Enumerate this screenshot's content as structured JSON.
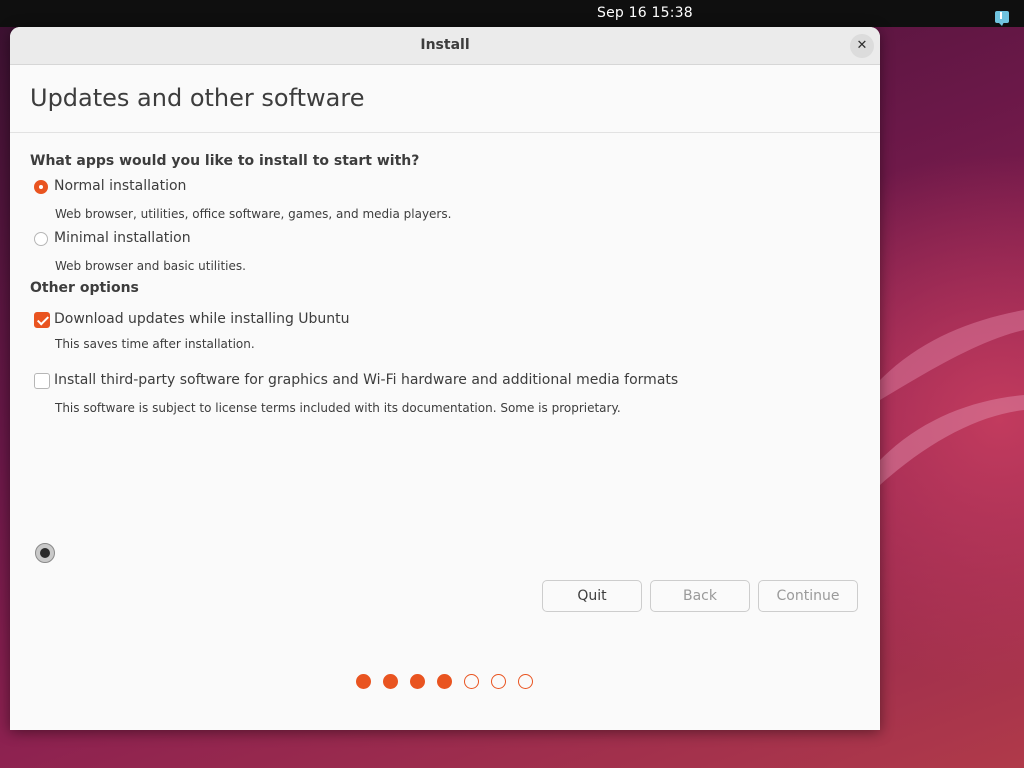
{
  "topbar": {
    "clock": "Sep 16  15:38",
    "notification_icon": "notification-icon"
  },
  "window": {
    "title": "Install",
    "close_icon": "close-icon"
  },
  "page": {
    "title": "Updates and other software"
  },
  "apps_section": {
    "heading": "What apps would you like to install to start with?",
    "options": [
      {
        "label": "Normal installation",
        "description": "Web browser, utilities, office software, games, and media players.",
        "selected": true
      },
      {
        "label": "Minimal installation",
        "description": "Web browser and basic utilities.",
        "selected": false
      }
    ]
  },
  "other_options": {
    "heading": "Other options",
    "items": [
      {
        "label": "Download updates while installing Ubuntu",
        "description": "This saves time after installation.",
        "checked": true
      },
      {
        "label": "Install third-party software for graphics and Wi-Fi hardware and additional media formats",
        "description": "This software is subject to license terms included with its documentation. Some is proprietary.",
        "checked": false
      }
    ]
  },
  "buttons": {
    "quit": "Quit",
    "back": "Back",
    "continue": "Continue"
  },
  "progress": {
    "current_step": 4,
    "total_steps": 7
  },
  "colors": {
    "accent": "#e95420",
    "topbar": "#0f0f0f",
    "window_bg": "#fafafa"
  }
}
